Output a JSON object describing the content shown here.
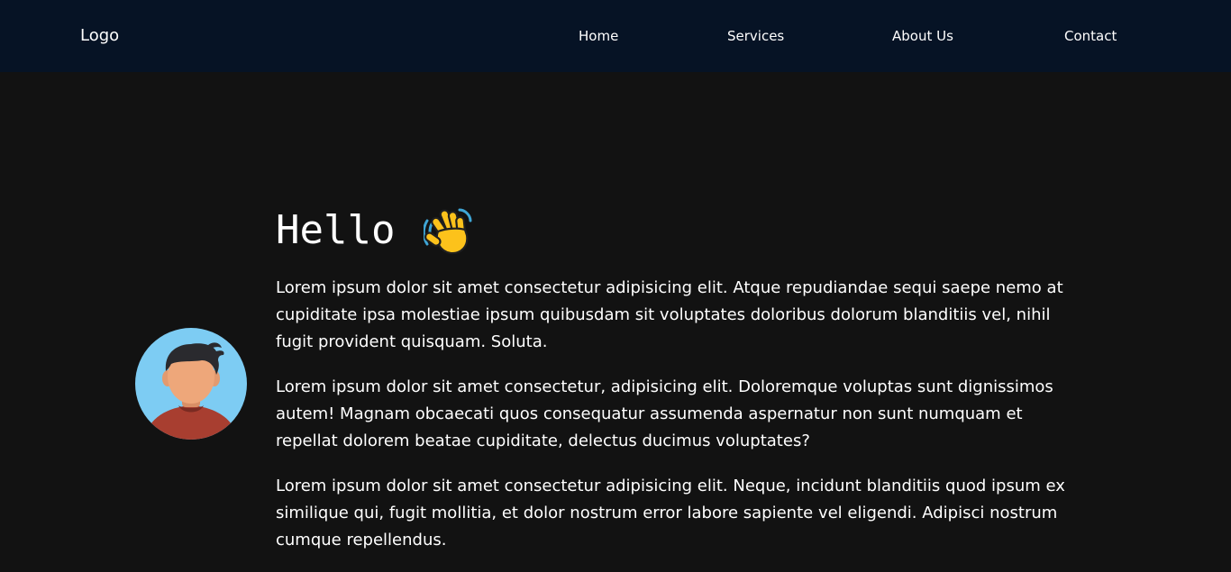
{
  "nav": {
    "logo": "Logo",
    "links": [
      "Home",
      "Services",
      "About Us",
      "Contact"
    ]
  },
  "hero": {
    "greeting": "Hello",
    "paragraphs": [
      "Lorem ipsum dolor sit amet consectetur adipisicing elit. Atque repudiandae sequi saepe nemo at cupiditate ipsa molestiae ipsum quibusdam sit voluptates doloribus dolorum blanditiis vel, nihil fugit provident quisquam. Soluta.",
      "Lorem ipsum dolor sit amet consectetur, adipisicing elit. Doloremque voluptas sunt dignissimos autem! Magnam obcaecati quos consequatur assumenda aspernatur non sunt numquam et repellat dolorem beatae cupiditate, delectus ducimus voluptates?",
      "Lorem ipsum dolor sit amet consectetur adipisicing elit. Neque, incidunt blanditiis quod ipsum ex similique qui, fugit mollitia, et dolor nostrum error labore sapiente vel eligendi. Adipisci nostrum cumque repellendus."
    ]
  },
  "colors": {
    "navbar_bg": "#061325",
    "page_bg": "#121212",
    "text": "#ffffff",
    "avatar_bg": "#7dccf3",
    "avatar_shirt": "#a83e30",
    "avatar_skin": "#eea77a",
    "avatar_hair": "#2a2a2e"
  },
  "icons": {
    "greeting_icon": "waving-hand-icon",
    "avatar": "user-avatar-illustration"
  }
}
